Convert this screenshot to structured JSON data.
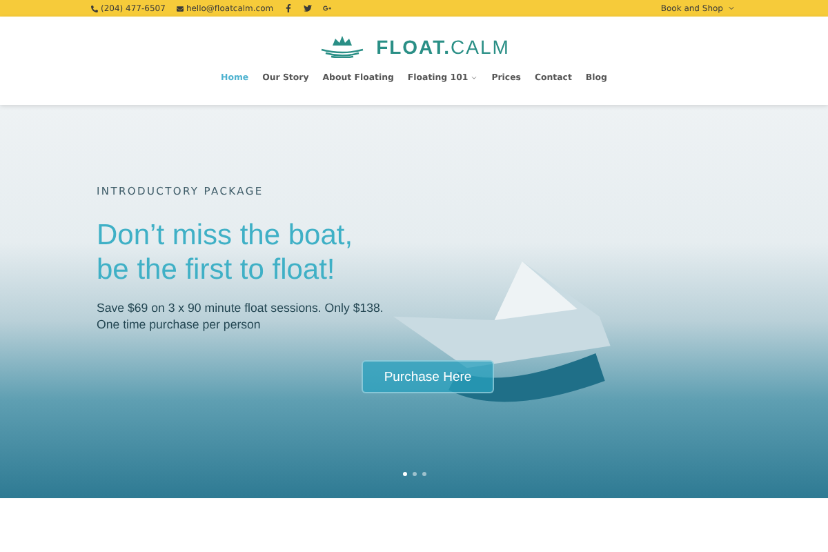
{
  "top_bar": {
    "phone": "(204) 477-6507",
    "email": "hello@floatcalm.com",
    "menu": {
      "label": "Book and Shop"
    }
  },
  "logo": {
    "bold": "FLOAT.",
    "light": "CALM"
  },
  "nav": [
    {
      "label": "Home",
      "selected": true,
      "dropdown": false
    },
    {
      "label": "Our Story",
      "selected": false,
      "dropdown": false
    },
    {
      "label": "About Floating",
      "selected": false,
      "dropdown": false
    },
    {
      "label": "Floating 101",
      "selected": false,
      "dropdown": true
    },
    {
      "label": "Prices",
      "selected": false,
      "dropdown": false
    },
    {
      "label": "Contact",
      "selected": false,
      "dropdown": false
    },
    {
      "label": "Blog",
      "selected": false,
      "dropdown": false
    }
  ],
  "hero": {
    "eyebrow": "INTRODUCTORY PACKAGE",
    "heading": [
      "Don’t miss the boat,",
      "be the first to float!"
    ],
    "body": [
      "Save $69 on 3 x 90 minute float sessions. Only $138.",
      "One time purchase per person"
    ],
    "button": "Purchase Here",
    "dots": [
      {
        "selected": true
      },
      {
        "selected": false
      },
      {
        "selected": false
      }
    ]
  }
}
